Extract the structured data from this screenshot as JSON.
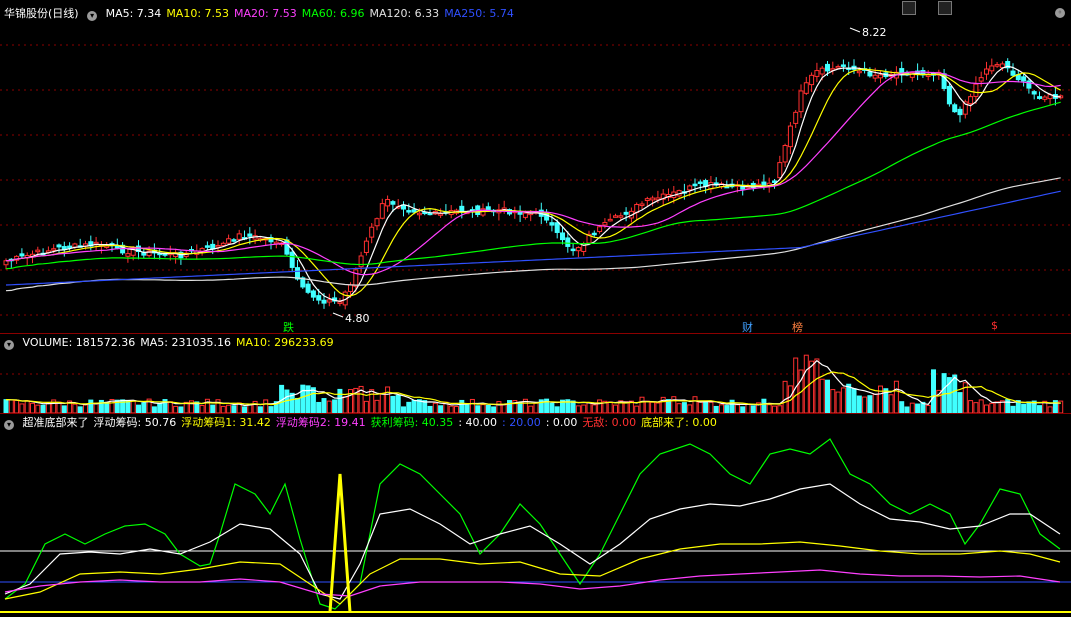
{
  "main": {
    "name": "华锦股份",
    "period": "(日线)",
    "ma": [
      {
        "label": "MA5: 7.34",
        "color": "#ffffff"
      },
      {
        "label": "MA10: 7.53",
        "color": "#ffff00"
      },
      {
        "label": "MA20: 7.53",
        "color": "#ff40ff"
      },
      {
        "label": "MA60: 6.96",
        "color": "#00ff00"
      },
      {
        "label": "MA120: 6.33",
        "color": "#e0e0e0"
      },
      {
        "label": "MA250: 5.74",
        "color": "#3050ff"
      }
    ],
    "high_label": "8.22",
    "low_label": "4.80",
    "markers": [
      {
        "text": "跌",
        "color": "#00ff00"
      },
      {
        "text": "财",
        "color": "#40a0ff"
      },
      {
        "text": "榜",
        "color": "#ff8040"
      },
      {
        "text": "$",
        "color": "#ff3030"
      }
    ]
  },
  "volume": {
    "items": [
      {
        "label": "VOLUME: 181572.36",
        "color": "#ffffff"
      },
      {
        "label": "MA5: 231035.16",
        "color": "#ffffff"
      },
      {
        "label": "MA10: 296233.69",
        "color": "#ffff00"
      }
    ]
  },
  "indicator": {
    "items": [
      {
        "label": "超准底部来了",
        "color": "#ffffff"
      },
      {
        "label": "浮动筹码: 50.76",
        "color": "#ffffff"
      },
      {
        "label": "浮动筹码1: 31.42",
        "color": "#ffff00"
      },
      {
        "label": "浮动筹码2: 19.41",
        "color": "#ff40ff"
      },
      {
        "label": "获利筹码: 40.35",
        "color": "#00ff00"
      },
      {
        "label": ": 40.00",
        "color": "#ffffff"
      },
      {
        "label": ": 20.00",
        "color": "#3050ff"
      },
      {
        "label": ": 0.00",
        "color": "#ffffff"
      },
      {
        "label": "无敌: 0.00",
        "color": "#ff3030"
      },
      {
        "label": "底部来了: 0.00",
        "color": "#ffff00"
      }
    ]
  },
  "colors": {
    "up": "#ff3030",
    "down": "#40ffff",
    "grid": "#8b0000",
    "bg": "#000000"
  }
}
